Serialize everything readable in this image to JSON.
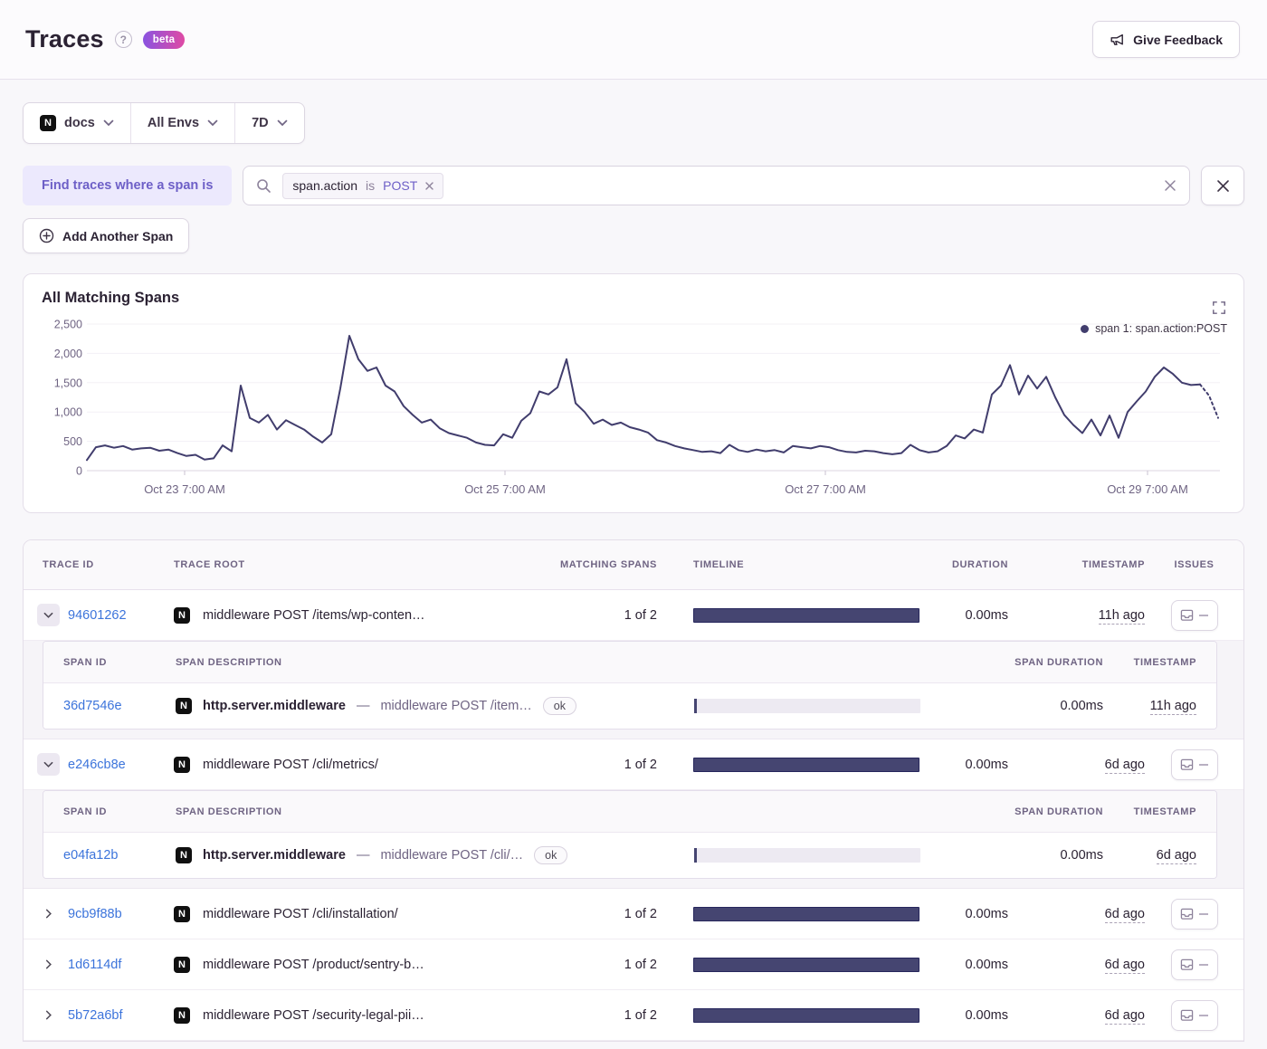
{
  "header": {
    "title": "Traces",
    "help_label": "?",
    "beta_label": "beta",
    "feedback_label": "Give Feedback"
  },
  "filters": {
    "project": "docs",
    "environment": "All Envs",
    "date_range": "7D"
  },
  "search": {
    "where_label": "Find traces where a span is",
    "filter": {
      "key": "span.action",
      "operator": "is",
      "value": "POST"
    },
    "add_label": "Add Another Span"
  },
  "colors": {
    "timeline_bar": "#454571",
    "timeline_bar_border": "#26265c",
    "link_blue": "#3c74db",
    "accent_purple": "#6d5fc7",
    "beta_gradient_from": "#8a53e0",
    "beta_gradient_to": "#df4aa4"
  },
  "chart_data": {
    "type": "line",
    "title": "All Matching Spans",
    "legend_label": "span 1: span.action:POST",
    "legend_position": "top-right",
    "grid": true,
    "ylim": [
      0,
      2500
    ],
    "y_ticks": [
      "2,500",
      "2,000",
      "1,500",
      "1,000",
      "500",
      "0"
    ],
    "x_tick_labels": [
      "Oct 23 7:00 AM",
      "Oct 25 7:00 AM",
      "Oct 27 7:00 AM",
      "Oct 29 7:00 AM"
    ],
    "line_color": "#413d6d",
    "dashed_tail_points": 3,
    "values": [
      180,
      400,
      430,
      390,
      420,
      360,
      380,
      390,
      340,
      360,
      300,
      250,
      270,
      190,
      210,
      430,
      330,
      1450,
      900,
      820,
      950,
      700,
      860,
      780,
      700,
      580,
      480,
      620,
      1400,
      2300,
      1900,
      1700,
      1760,
      1450,
      1350,
      1100,
      950,
      820,
      870,
      720,
      640,
      600,
      560,
      480,
      440,
      430,
      620,
      560,
      850,
      980,
      1350,
      1300,
      1420,
      1900,
      1150,
      1000,
      800,
      870,
      780,
      820,
      740,
      700,
      650,
      520,
      480,
      420,
      380,
      350,
      320,
      330,
      300,
      440,
      350,
      320,
      360,
      330,
      350,
      310,
      420,
      400,
      380,
      420,
      400,
      350,
      320,
      310,
      340,
      330,
      300,
      280,
      300,
      440,
      350,
      310,
      330,
      420,
      600,
      550,
      700,
      650,
      1300,
      1450,
      1800,
      1300,
      1620,
      1400,
      1600,
      1250,
      950,
      780,
      640,
      870,
      600,
      940,
      560,
      1000,
      1180,
      1350,
      1600,
      1760,
      1650,
      1500,
      1460,
      1470,
      1280,
      900
    ]
  },
  "table": {
    "headers": {
      "trace_id": "Trace ID",
      "trace_root": "Trace Root",
      "matching_spans": "Matching Spans",
      "timeline": "Timeline",
      "duration": "Duration",
      "timestamp": "Timestamp",
      "issues": "Issues"
    },
    "span_headers": {
      "span_id": "Span ID",
      "span_description": "Span Description",
      "span_duration": "Span Duration",
      "timestamp": "Timestamp"
    },
    "rows": [
      {
        "trace_id": "94601262",
        "trace_root": "middleware POST /items/wp-conten…",
        "matching_spans": "1 of 2",
        "duration": "0.00ms",
        "timestamp": "11h ago",
        "spans": [
          {
            "span_id": "36d7546e",
            "op": "http.server.middleware",
            "separator": "—",
            "description": "middleware POST /item…",
            "status": "ok",
            "span_duration": "0.00ms",
            "timestamp": "11h ago"
          }
        ]
      },
      {
        "trace_id": "e246cb8e",
        "trace_root": "middleware POST /cli/metrics/",
        "matching_spans": "1 of 2",
        "duration": "0.00ms",
        "timestamp": "6d ago",
        "spans": [
          {
            "span_id": "e04fa12b",
            "op": "http.server.middleware",
            "separator": "—",
            "description": "middleware POST /cli/…",
            "status": "ok",
            "span_duration": "0.00ms",
            "timestamp": "6d ago"
          }
        ]
      },
      {
        "trace_id": "9cb9f88b",
        "trace_root": "middleware POST /cli/installation/",
        "matching_spans": "1 of 2",
        "duration": "0.00ms",
        "timestamp": "6d ago"
      },
      {
        "trace_id": "1d6114df",
        "trace_root": "middleware POST /product/sentry-b…",
        "matching_spans": "1 of 2",
        "duration": "0.00ms",
        "timestamp": "6d ago"
      },
      {
        "trace_id": "5b72a6bf",
        "trace_root": "middleware POST /security-legal-pii…",
        "matching_spans": "1 of 2",
        "duration": "0.00ms",
        "timestamp": "6d ago"
      }
    ]
  }
}
